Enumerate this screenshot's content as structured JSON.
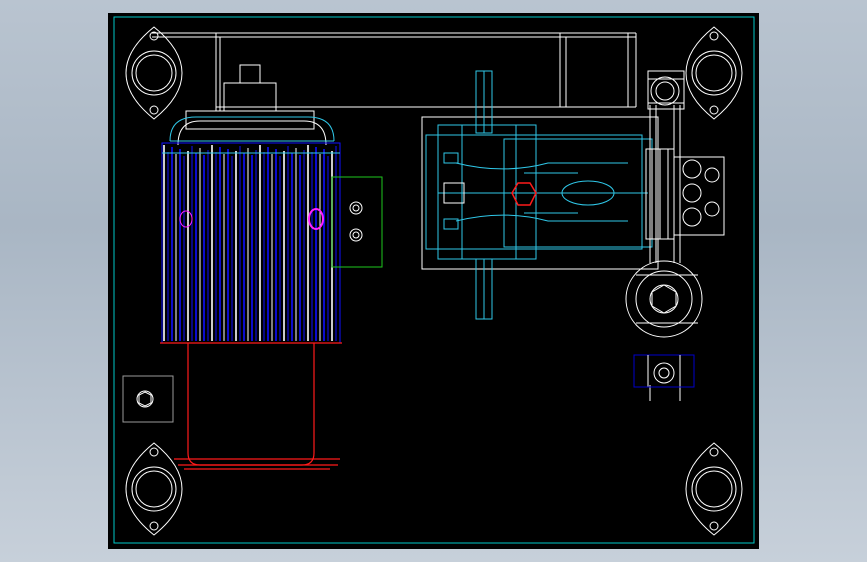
{
  "viewport": {
    "background": "#000000",
    "frame_color": "#00c8c8"
  },
  "colors": {
    "white": "#ffffff",
    "cyan": "#2fc7e8",
    "blue": "#1010ff",
    "red": "#ff1a1a",
    "magenta": "#ff22ff",
    "green": "#1ec81e",
    "grey": "#9a9a9a",
    "navy": "#0000cc"
  },
  "components": [
    {
      "name": "mounting-flange",
      "count": 4
    },
    {
      "name": "electric-motor",
      "count": 1
    },
    {
      "name": "motor-terminal-box",
      "count": 1
    },
    {
      "name": "motor-base-outline",
      "count": 1
    },
    {
      "name": "plunger-pump",
      "count": 1
    },
    {
      "name": "pump-manifold",
      "count": 1
    },
    {
      "name": "pipe-union",
      "count": 3
    },
    {
      "name": "gauge-port",
      "count": 1
    }
  ]
}
